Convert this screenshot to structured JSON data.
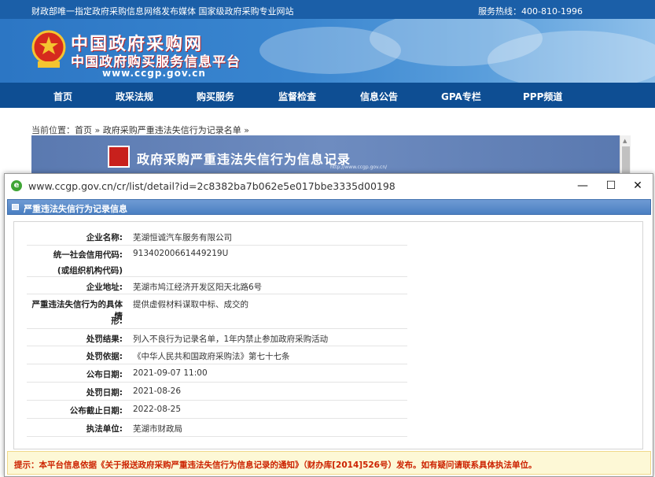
{
  "topbar": {
    "left_text": "财政部唯一指定政府采购信息网络发布媒体 国家级政府采购专业网站",
    "hotline": "服务热线：400-810-1996"
  },
  "header": {
    "title_line1": "中国政府采购网",
    "title_line2": "中国政府购买服务信息平台",
    "url": "www.ccgp.gov.cn"
  },
  "nav": {
    "items": [
      "首页",
      "政采法规",
      "购买服务",
      "监督检查",
      "信息公告",
      "GPA专栏",
      "PPP频道"
    ]
  },
  "breadcrumb": {
    "prefix": "当前位置：",
    "home": "首页",
    "sep": " » ",
    "current": "政府采购严重违法失信行为记录名单",
    "suffix": " »"
  },
  "record_banner": {
    "title": "政府采购严重违法失信行为信息记录",
    "small_url": "http://www.ccgp.gov.cn/"
  },
  "popup": {
    "url": "www.ccgp.gov.cn/cr/list/detail?id=2c8382ba7b062e5e017bbe3335d00198",
    "minimize": "—",
    "maximize": "☐",
    "close": "✕",
    "section_title": "严重违法失信行为记录信息",
    "fields": [
      {
        "label": "企业名称:",
        "value": "芜湖恒诚汽车服务有限公司"
      },
      {
        "label": "统一社会信用代码:",
        "value": "91340200661449219U"
      },
      {
        "label": "(或组织机构代码)",
        "value": ""
      },
      {
        "label": "企业地址:",
        "value": "芜湖市鸠江经济开发区阳天北路6号"
      },
      {
        "label": "严重违法失信行为的具体情",
        "value": "提供虚假材料谋取中标、成交的"
      },
      {
        "label": "形:",
        "value": ""
      },
      {
        "label": "处罚结果:",
        "value": "列入不良行为记录名单，1年内禁止参加政府采购活动"
      },
      {
        "label": "处罚依据:",
        "value": "《中华人民共和国政府采购法》第七十七条"
      },
      {
        "label": "公布日期:",
        "value": "2021-09-07 11:00"
      },
      {
        "label": "处罚日期:",
        "value": "2021-08-26"
      },
      {
        "label": "公布截止日期:",
        "value": "2022-08-25"
      },
      {
        "label": "执法单位:",
        "value": "芜湖市财政局"
      }
    ],
    "notice": "提示：本平台信息依据《关于报送政府采购严重违法失信行为信息记录的通知》（财办库[2014]526号）发布。如有疑问请联系具体执法单位。"
  },
  "colors": {
    "nav_bg": "#0e4e93",
    "banner_bg": "#2c76c4",
    "notice_text": "#cc2200",
    "notice_bg": "#fdf8d6"
  }
}
